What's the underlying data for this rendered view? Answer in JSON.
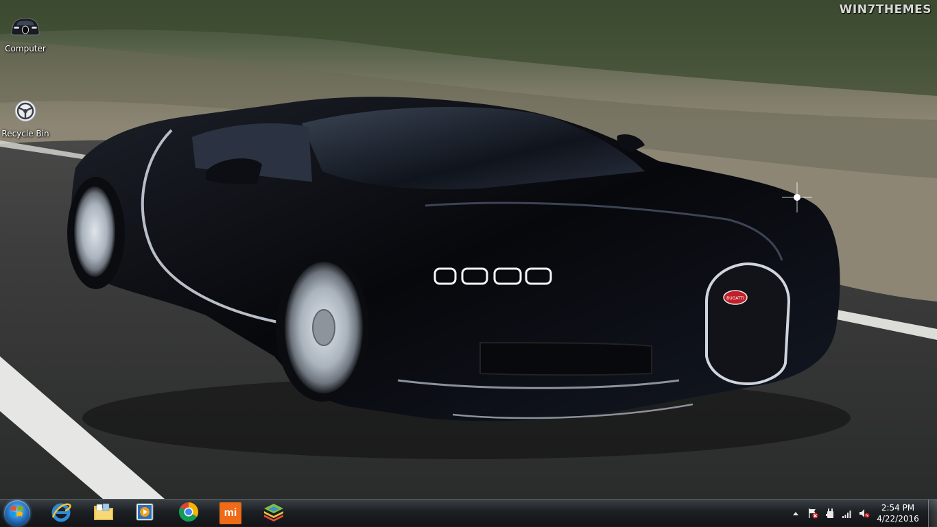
{
  "wallpaper": {
    "watermark": "WIN7THEMES",
    "badge": "BUGATTI"
  },
  "desktop": {
    "icons": [
      {
        "label": "Computer",
        "icon": "car-icon"
      },
      {
        "label": "Recycle Bin",
        "icon": "steering-wheel-icon"
      }
    ]
  },
  "taskbar": {
    "start": {
      "icon": "windows-logo-icon"
    },
    "pinned": [
      {
        "name": "Internet Explorer",
        "icon": "internet-explorer-icon"
      },
      {
        "name": "Windows Explorer",
        "icon": "folder-explorer-icon"
      },
      {
        "name": "Windows Media Player",
        "icon": "media-player-icon"
      },
      {
        "name": "Google Chrome",
        "icon": "chrome-icon"
      },
      {
        "name": "Mi",
        "icon": "mi-icon",
        "text": "mi"
      },
      {
        "name": "BlueStacks",
        "icon": "bluestacks-icon"
      }
    ],
    "tray": {
      "icons": [
        "show-hidden-icons-arrow",
        "action-center-flag-icon",
        "power-icon",
        "network-signal-icon",
        "volume-muted-icon"
      ]
    },
    "clock": {
      "time": "2:54 PM",
      "date": "4/22/2016"
    }
  },
  "colors": {
    "road": "#3b3d3c",
    "car_body": "#0b0d12",
    "taskbar": "#1e2226",
    "start_orb": "#2a78c8",
    "bugatti_badge": "#c0202a"
  }
}
